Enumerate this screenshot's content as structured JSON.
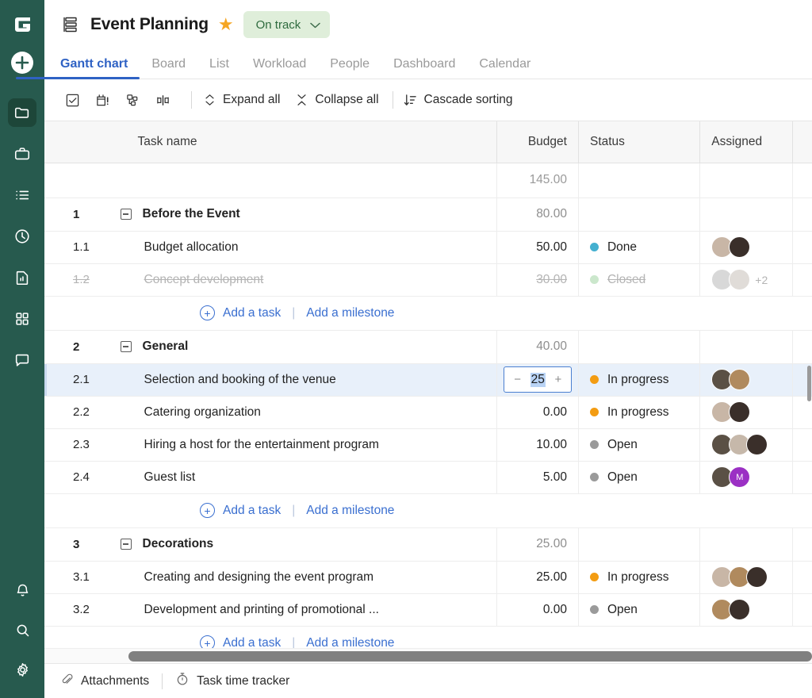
{
  "colors": {
    "sidebar_bg": "#275a4e",
    "accent_blue": "#2f62c4",
    "link_blue": "#3a6fd0",
    "status_chip_bg": "#dfeeda",
    "status_chip_text": "#2e6b3e",
    "selected_row_bg": "#e8f0fa",
    "done_dot": "#44b0d0",
    "closed_dot": "#cbe7cc",
    "inprogress_dot": "#f39c12",
    "open_dot": "#9a9a9a",
    "star": "#f5a623"
  },
  "sidebar": {
    "logo": "G",
    "create_button_label": "+",
    "items": [
      {
        "name": "projects",
        "icon": "folder-icon",
        "active": true
      },
      {
        "name": "portfolio",
        "icon": "briefcase-icon",
        "active": false
      },
      {
        "name": "tasks",
        "icon": "list-icon",
        "active": false
      },
      {
        "name": "time",
        "icon": "clock-icon",
        "active": false
      },
      {
        "name": "reports",
        "icon": "report-icon",
        "active": false
      },
      {
        "name": "apps",
        "icon": "grid-icon",
        "active": false
      },
      {
        "name": "chat",
        "icon": "chat-icon",
        "active": false
      }
    ],
    "bottom_items": [
      {
        "name": "notifications",
        "icon": "bell-icon"
      },
      {
        "name": "search",
        "icon": "search-icon"
      },
      {
        "name": "settings",
        "icon": "gear-icon"
      }
    ]
  },
  "header": {
    "project_icon": "stacked-layers-icon",
    "title": "Event Planning",
    "favorite_icon": "star-icon",
    "status": {
      "label": "On track",
      "chevron": "⌄"
    }
  },
  "tabs": [
    {
      "label": "Gantt chart",
      "active": true
    },
    {
      "label": "Board",
      "active": false
    },
    {
      "label": "List",
      "active": false
    },
    {
      "label": "Workload",
      "active": false
    },
    {
      "label": "People",
      "active": false
    },
    {
      "label": "Dashboard",
      "active": false
    },
    {
      "label": "Calendar",
      "active": false
    }
  ],
  "toolbar": {
    "icons": [
      {
        "name": "checkbox-icon"
      },
      {
        "name": "calendar-alert-icon"
      },
      {
        "name": "hierarchy-icon"
      },
      {
        "name": "resize-columns-icon"
      }
    ],
    "expand_all": "Expand all",
    "collapse_all": "Collapse all",
    "cascade_sorting": "Cascade sorting"
  },
  "table": {
    "columns": [
      "",
      "Task name",
      "Budget",
      "Status",
      "Assigned",
      "+"
    ],
    "total_row": {
      "budget": "145.00"
    },
    "rows": [
      {
        "type": "group",
        "num": "1",
        "name": "Before the Event",
        "budget": "80.00",
        "status": "",
        "status_color": "",
        "avatars": []
      },
      {
        "type": "task",
        "num": "1.1",
        "name": "Budget allocation",
        "budget": "50.00",
        "status": "Done",
        "status_color": "#44b0d0",
        "avatars": [
          {
            "bg": "#c8b6a6",
            "initial": ""
          },
          {
            "bg": "#3a2f2a",
            "initial": ""
          }
        ]
      },
      {
        "type": "task",
        "num": "1.2",
        "name": "Concept development",
        "budget": "30.00",
        "status": "Closed",
        "status_color": "#cbe7cc",
        "muted": true,
        "avatars": [
          {
            "bg": "#d8d8d8",
            "initial": ""
          },
          {
            "bg": "#e0dcd8",
            "initial": ""
          }
        ],
        "avatar_more": "+2"
      },
      {
        "type": "add",
        "add_task": "Add a task",
        "add_milestone": "Add a milestone"
      },
      {
        "type": "group",
        "num": "2",
        "name": "General",
        "budget": "40.00",
        "status": "",
        "status_color": "",
        "avatars": []
      },
      {
        "type": "task",
        "num": "2.1",
        "name": "Selection and booking of the venue",
        "budget": "25",
        "editing": true,
        "minus": "−",
        "plus": "+",
        "status": "In progress",
        "status_color": "#f39c12",
        "selected": true,
        "avatars": [
          {
            "bg": "#5a5045",
            "initial": ""
          },
          {
            "bg": "#b08a5e",
            "initial": ""
          }
        ]
      },
      {
        "type": "task",
        "num": "2.2",
        "name": "Catering organization",
        "budget": "0.00",
        "status": "In progress",
        "status_color": "#f39c12",
        "avatars": [
          {
            "bg": "#c8b6a6",
            "initial": ""
          },
          {
            "bg": "#3a2f2a",
            "initial": ""
          }
        ]
      },
      {
        "type": "task",
        "num": "2.3",
        "name": "Hiring a host for the entertainment program",
        "budget": "10.00",
        "status": "Open",
        "status_color": "#9a9a9a",
        "avatars": [
          {
            "bg": "#5a5045",
            "initial": ""
          },
          {
            "bg": "#c6b8aa",
            "initial": ""
          },
          {
            "bg": "#3a2f2a",
            "initial": ""
          }
        ]
      },
      {
        "type": "task",
        "num": "2.4",
        "name": "Guest list",
        "budget": "5.00",
        "status": "Open",
        "status_color": "#9a9a9a",
        "avatars": [
          {
            "bg": "#5a5045",
            "initial": ""
          },
          {
            "bg": "#9b30c4",
            "initial": "M"
          }
        ]
      },
      {
        "type": "add",
        "add_task": "Add a task",
        "add_milestone": "Add a milestone"
      },
      {
        "type": "group",
        "num": "3",
        "name": "Decorations",
        "budget": "25.00",
        "status": "",
        "status_color": "",
        "avatars": []
      },
      {
        "type": "task",
        "num": "3.1",
        "name": "Creating and designing the event program",
        "budget": "25.00",
        "status": "In progress",
        "status_color": "#f39c12",
        "avatars": [
          {
            "bg": "#c8b6a6",
            "initial": ""
          },
          {
            "bg": "#b08a5e",
            "initial": ""
          },
          {
            "bg": "#3a2f2a",
            "initial": ""
          }
        ]
      },
      {
        "type": "task",
        "num": "3.2",
        "name": "Development and printing of promotional ...",
        "budget": "0.00",
        "status": "Open",
        "status_color": "#9a9a9a",
        "avatars": [
          {
            "bg": "#b08a5e",
            "initial": ""
          },
          {
            "bg": "#3a2f2a",
            "initial": ""
          }
        ]
      },
      {
        "type": "add",
        "add_task": "Add a task",
        "add_milestone": "Add a milestone"
      }
    ],
    "row_menu": "···"
  },
  "footer": {
    "attachments": "Attachments",
    "task_time_tracker": "Task time tracker"
  }
}
